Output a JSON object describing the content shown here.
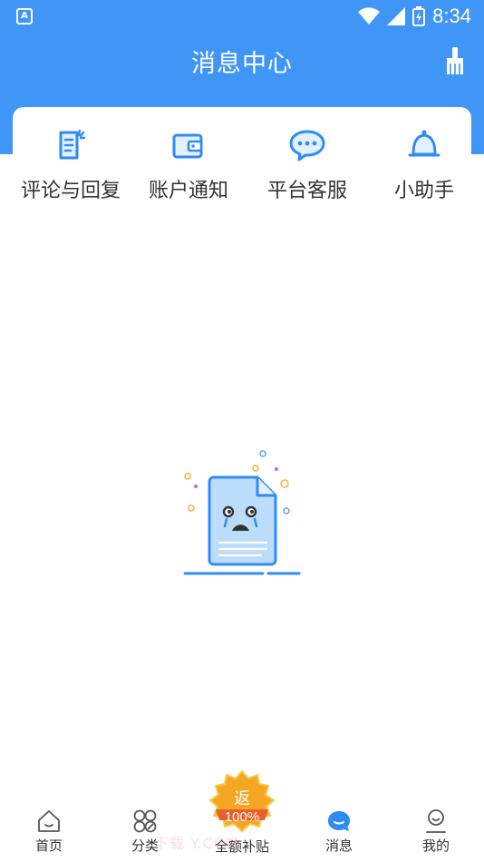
{
  "status_bar": {
    "time": "8:34",
    "app_icon_letter": "A"
  },
  "header": {
    "title": "消息中心"
  },
  "categories": [
    {
      "label": "评论与回复",
      "icon": "comment-doc-icon"
    },
    {
      "label": "账户通知",
      "icon": "wallet-icon"
    },
    {
      "label": "平台客服",
      "icon": "chat-bubble-icon"
    },
    {
      "label": "小助手",
      "icon": "bell-icon"
    }
  ],
  "tabbar": {
    "items": [
      {
        "label": "首页",
        "icon": "home-icon"
      },
      {
        "label": "分类",
        "icon": "grid-icon"
      },
      {
        "label": "全额补贴",
        "icon": "subsidy-badge-icon"
      },
      {
        "label": "消息",
        "icon": "message-icon"
      },
      {
        "label": "我的",
        "icon": "profile-icon"
      }
    ],
    "badge_text": "返",
    "badge_percent": "100%"
  },
  "watermark": "下载 Y.COM",
  "colors": {
    "primary": "#3f96f6",
    "accent_icon": "#2f8cf5",
    "badge": "#f5a623"
  }
}
